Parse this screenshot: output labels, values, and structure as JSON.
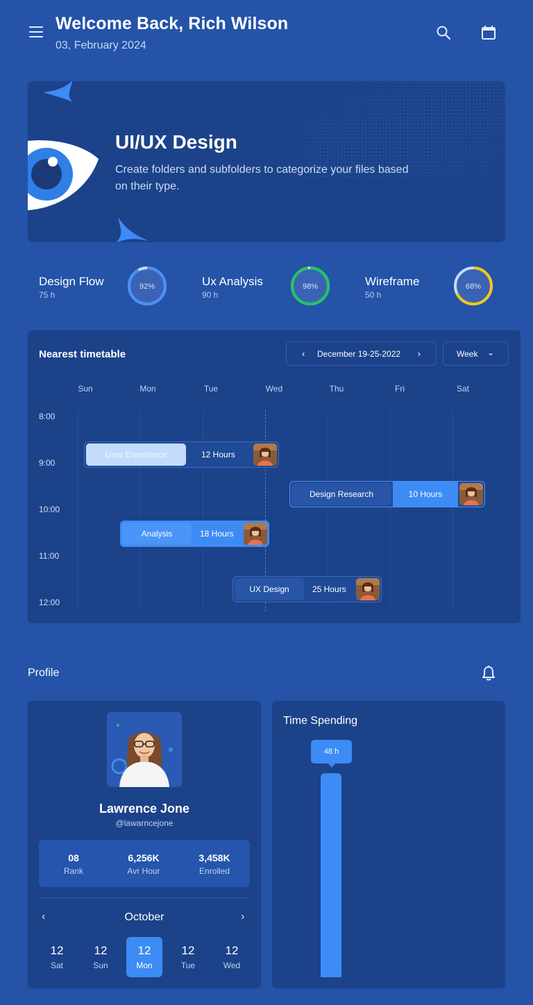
{
  "header": {
    "title": "Welcome Back, Rich Wilson",
    "date": "03, February 2024"
  },
  "banner": {
    "title": "UI/UX Design",
    "description": "Create folders and subfolders to categorize your files based on their type."
  },
  "stats": [
    {
      "name": "Design Flow",
      "hours": "75 h",
      "percent": 92,
      "label": "92%",
      "color": "#4a90f5"
    },
    {
      "name": "Ux Analysis",
      "hours": "90 h",
      "percent": 98,
      "label": "98%",
      "color": "#22c55e"
    },
    {
      "name": "Wireframe",
      "hours": "50 h",
      "percent": 68,
      "label": "68%",
      "color": "#f5c518"
    }
  ],
  "timetable": {
    "title": "Nearest timetable",
    "range": "December 19-25-2022",
    "view": "Week",
    "days": [
      "Sun",
      "Mon",
      "Tue",
      "Wed",
      "Thu",
      "Fri",
      "Sat"
    ],
    "times": [
      "8:00",
      "9:00",
      "10:00",
      "11:00",
      "12:00"
    ],
    "events": [
      {
        "task": "User Experience",
        "hours": "12 Hours"
      },
      {
        "task": "Design Research",
        "hours": "10 Hours"
      },
      {
        "task": "Analysis",
        "hours": "18 Hours"
      },
      {
        "task": "UX Design",
        "hours": "25 Hours"
      }
    ]
  },
  "profile": {
    "section_title": "Profile",
    "name": "Lawrence Jone",
    "handle": "@lawarncejone",
    "stats": [
      {
        "value": "08",
        "label": "Rank"
      },
      {
        "value": "6,256K",
        "label": "Avr Hour"
      },
      {
        "value": "3,458K",
        "label": "Enrolled"
      }
    ],
    "calendar": {
      "month": "October",
      "days": [
        {
          "num": "12",
          "day": "Sat",
          "active": false
        },
        {
          "num": "12",
          "day": "Sun",
          "active": false
        },
        {
          "num": "12",
          "day": "Mon",
          "active": true
        },
        {
          "num": "12",
          "day": "Tue",
          "active": false
        },
        {
          "num": "12",
          "day": "Wed",
          "active": false
        }
      ]
    }
  },
  "time_spending": {
    "title": "Time Spending",
    "value_label": "48 h"
  },
  "icons": {
    "menu": "menu-icon",
    "search": "search-icon",
    "calendar": "calendar-icon",
    "bell": "bell-icon"
  },
  "colors": {
    "background": "#2453a8",
    "card": "#1c4289",
    "accent": "#3d8bf5"
  }
}
